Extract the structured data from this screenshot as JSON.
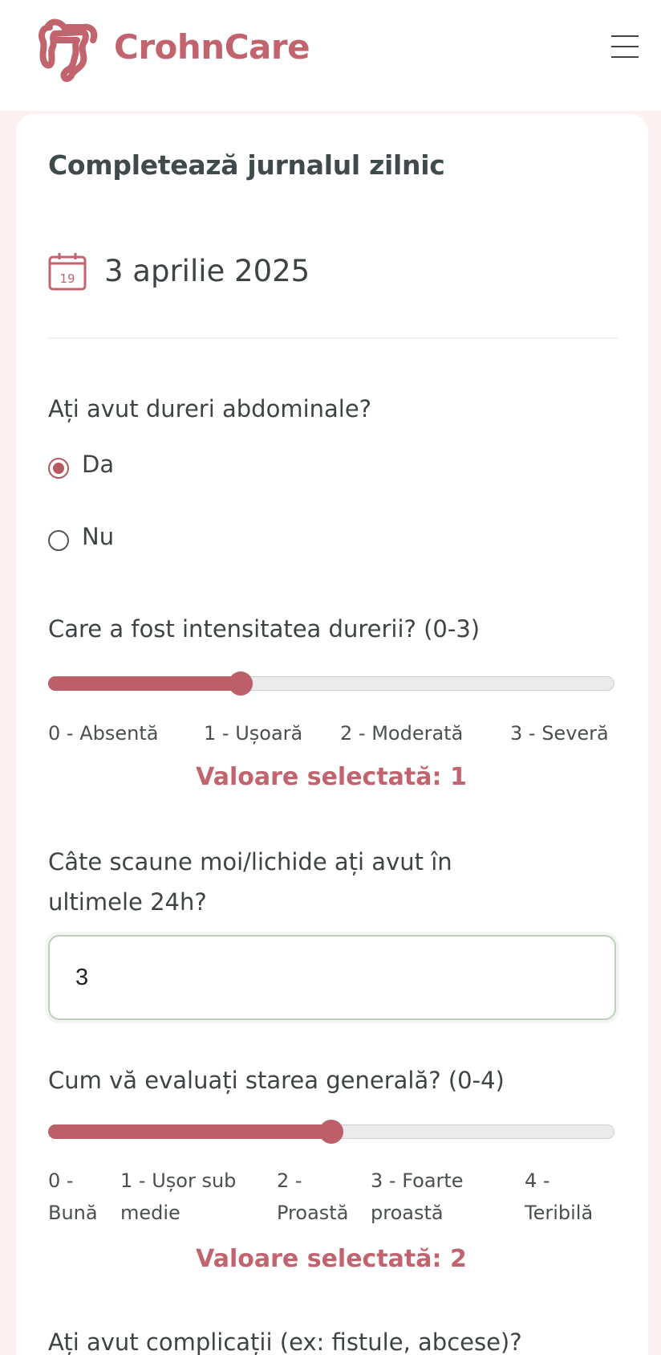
{
  "app": {
    "brand": "CrohnCare",
    "accent_color": "#c2646e",
    "icons": {
      "logo": "intestine-icon",
      "menu": "hamburger-menu-icon",
      "calendar": "calendar-icon"
    }
  },
  "form": {
    "title": "Completează jurnalul zilnic",
    "calendar_day": "19",
    "date": "3 aprilie 2025",
    "pain": {
      "question": "Ați avut dureri abdominale?",
      "options": [
        {
          "label": "Da",
          "checked": true
        },
        {
          "label": "Nu",
          "checked": false
        }
      ]
    },
    "intensity": {
      "question": "Care a fost intensitatea durerii? (0-3)",
      "min": 0,
      "max": 3,
      "value": 1,
      "scale": [
        "0 - Absentă",
        "1 - Ușoară",
        "2 - Moderată",
        "3 - Severă"
      ],
      "selected_text": "Valoare selectată: 1"
    },
    "stools": {
      "question_line1": "Câte scaune moi/lichide ați avut în",
      "question_line2": "ultimele 24h?",
      "value": "3"
    },
    "general": {
      "question": "Cum vă evaluați starea generală? (0-4)",
      "min": 0,
      "max": 4,
      "value": 2,
      "scale": [
        {
          "line1": "0 -",
          "line2": "Bună"
        },
        {
          "line1": "1 - Ușor sub",
          "line2": "medie"
        },
        {
          "line1": "2 -",
          "line2": "Proastă"
        },
        {
          "line1": "3 - Foarte",
          "line2": "proastă"
        },
        {
          "line1": "4 -",
          "line2": "Teribilă"
        }
      ],
      "selected_text": "Valoare selectată: 2"
    },
    "complications": {
      "question": "Ați avut complicații (ex: fistule, abcese)?"
    }
  }
}
